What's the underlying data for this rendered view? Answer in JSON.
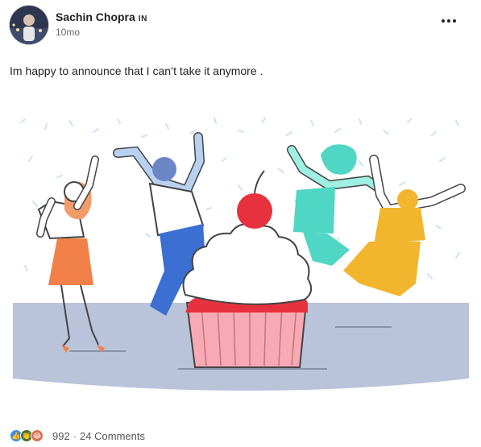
{
  "post": {
    "author": "Sachin Chopra",
    "author_flag": "IN",
    "time": "10mo",
    "text": "Im happy to announce that I can’t take it anymore ."
  },
  "footer": {
    "reaction_icons": [
      "like-icon",
      "celebrate-icon",
      "funny-icon"
    ],
    "reaction_count": "992",
    "separator": "·",
    "comments": "24 Comments"
  },
  "colors": {
    "cake_frosting": "#ffffff",
    "cherry": "#e8313f",
    "cupcake_wrapper": "#f7a9b4",
    "floor": "#b9c3d9",
    "person_orange": "#f18148",
    "person_blue": "#3b6fd1",
    "person_teal": "#4fd6c5",
    "person_yellow": "#f2b52e"
  }
}
